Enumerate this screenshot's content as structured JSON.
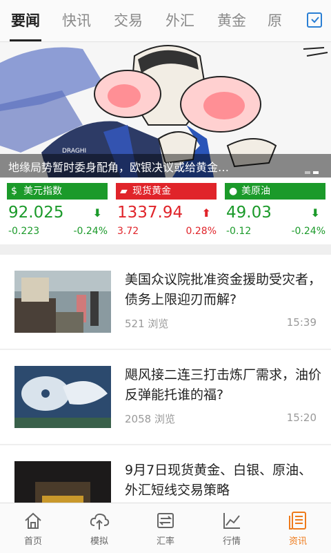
{
  "tabs": [
    {
      "label": "要闻",
      "active": true
    },
    {
      "label": "快讯"
    },
    {
      "label": "交易"
    },
    {
      "label": "外汇"
    },
    {
      "label": "黄金"
    },
    {
      "label": "原"
    }
  ],
  "banner": {
    "caption": "地缘局势暂时委身配角，欧银决议或给黄金…",
    "cartoon_name_tag": "DRAGHI"
  },
  "quotes": [
    {
      "name": "美元指数",
      "icon": "dollar-icon",
      "color": "#1b9a2a",
      "price": "92.025",
      "direction": "down",
      "change": "-0.223",
      "percent": "-0.24%"
    },
    {
      "name": "现货黄金",
      "icon": "gold-bars-icon",
      "color": "#e0242a",
      "price": "1337.94",
      "direction": "up",
      "change": "3.72",
      "percent": "0.28%"
    },
    {
      "name": "美原油",
      "icon": "oil-drop-icon",
      "color": "#1b9a2a",
      "price": "49.03",
      "direction": "down",
      "change": "-0.12",
      "percent": "-0.24%"
    }
  ],
  "news": [
    {
      "title": "美国众议院批准资金援助受灾者，债务上限迎刃而解?",
      "views": "521 浏览",
      "time": "15:39"
    },
    {
      "title": "飓风接二连三打击炼厂需求，油价反弹能托谁的福?",
      "views": "2058 浏览",
      "time": "15:20"
    },
    {
      "title": "9月7日现货黄金、白银、原油、外汇短线交易策略",
      "views": "",
      "time": ""
    }
  ],
  "bottom_nav": [
    {
      "label": "首页",
      "icon": "home-icon"
    },
    {
      "label": "模拟",
      "icon": "cloud-upload-icon"
    },
    {
      "label": "汇率",
      "icon": "exchange-icon"
    },
    {
      "label": "行情",
      "icon": "chart-icon"
    },
    {
      "label": "资讯",
      "icon": "news-icon",
      "active": true
    }
  ],
  "colors": {
    "accent": "#ee7a1a",
    "up": "#e0242a",
    "down": "#1b9a2a"
  }
}
